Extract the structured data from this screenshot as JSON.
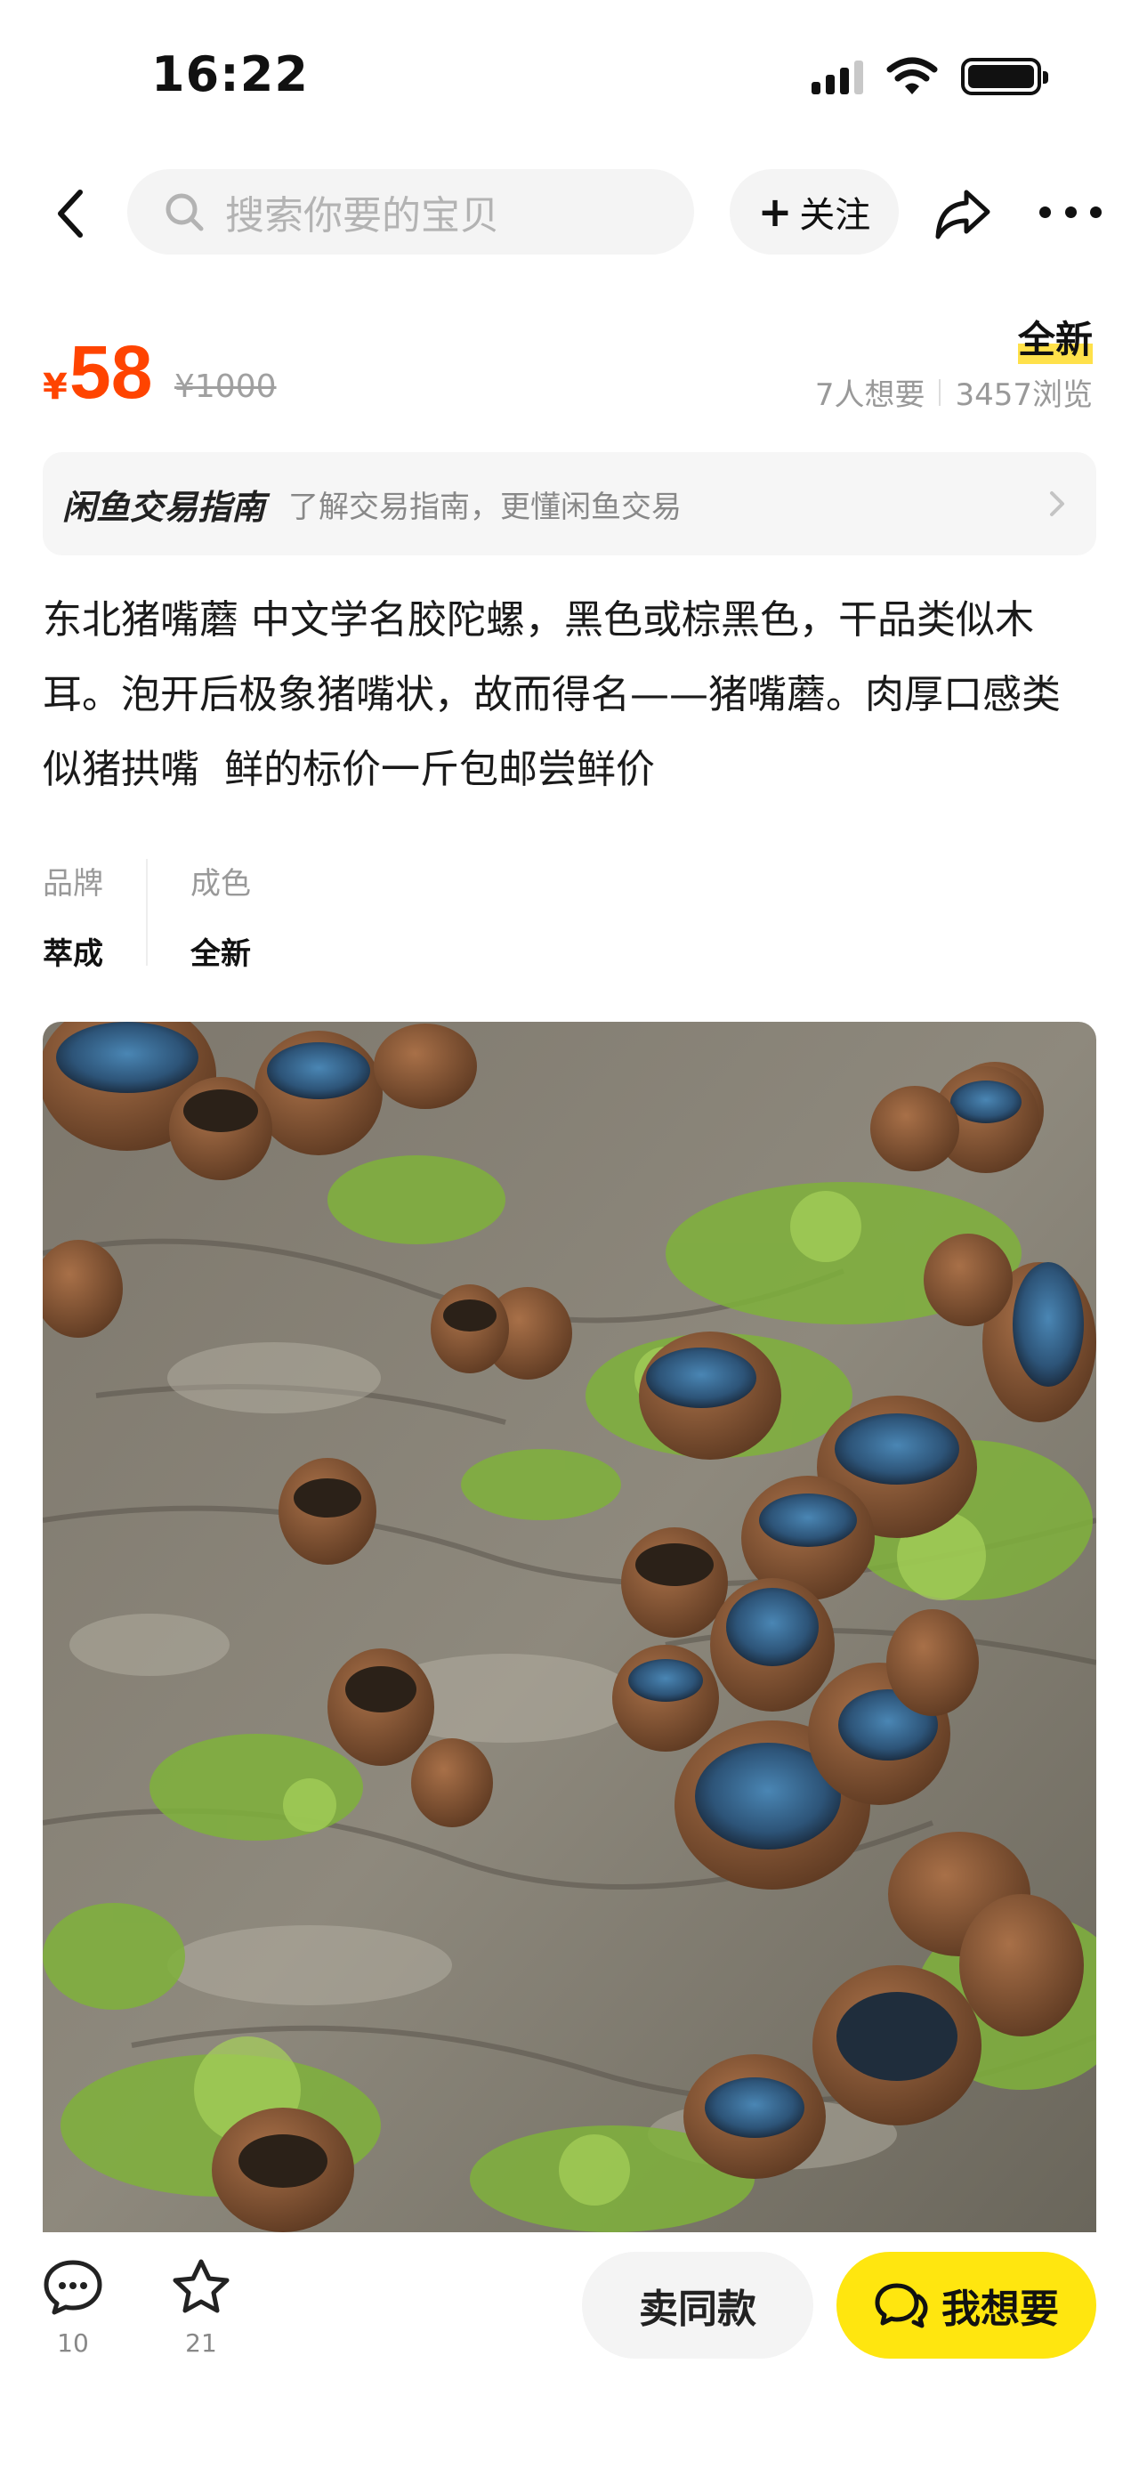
{
  "status_bar": {
    "time": "16:22"
  },
  "nav": {
    "search_placeholder": "搜索你要的宝贝",
    "follow_label": "关注",
    "follow_plus": "+"
  },
  "price": {
    "currency": "¥",
    "value": "58",
    "original": "¥1000",
    "condition_badge": "全新",
    "wants": "7人想要",
    "views": "3457浏览"
  },
  "guide": {
    "title": "闲鱼交易指南",
    "desc": "了解交易指南，更懂闲鱼交易"
  },
  "description": "东北猪嘴蘑 中文学名胶陀螺，黑色或棕黑色，干品类似木耳。泡开后极象猪嘴状，故而得名——猪嘴蘑。肉厚口感类似猪拱嘴  鲜的标价一斤包邮尝鲜价",
  "attributes": [
    {
      "key": "品牌",
      "value": "萃成"
    },
    {
      "key": "成色",
      "value": "全新"
    }
  ],
  "bottom_bar": {
    "comment_count": "10",
    "favorite_count": "21",
    "sell_same_label": "卖同款",
    "want_label": "我想要"
  },
  "colors": {
    "price": "#ff4400",
    "want_button": "#ffe60f",
    "badge_highlight": "#ffe14a"
  },
  "icons": [
    "back-icon",
    "search-icon",
    "share-icon",
    "more-icon",
    "chevron-right-icon",
    "comment-icon",
    "star-icon",
    "chat-icon"
  ]
}
